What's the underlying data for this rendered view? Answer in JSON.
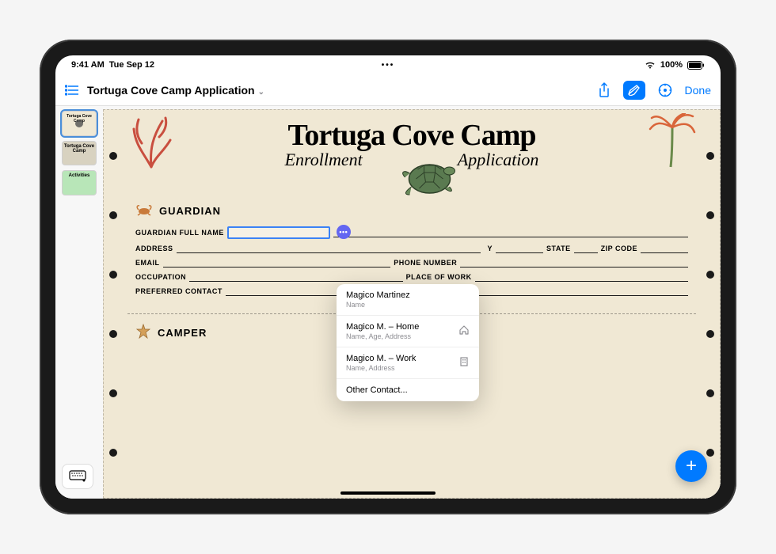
{
  "status": {
    "time": "9:41 AM",
    "date": "Tue Sep 12",
    "battery_pct": "100%"
  },
  "toolbar": {
    "title": "Tortuga Cove Camp Application",
    "done": "Done"
  },
  "sidebar": {
    "thumbs": [
      {
        "label": "Tortuga Cove Camp"
      },
      {
        "label": "Tortuga Cove Camp"
      },
      {
        "label": "Activities"
      }
    ]
  },
  "doc": {
    "title": "Tortuga Cove Camp",
    "sub_left": "Enrollment",
    "sub_right": "Application",
    "guardian_hdr": "GUARDIAN",
    "camper_hdr": "CAMPER",
    "labels": {
      "full_name": "GUARDIAN FULL NAME",
      "address": "ADDRESS",
      "city": "CITY",
      "state": "STATE",
      "zip": "ZIP CODE",
      "email": "EMAIL",
      "phone": "PHONE NUMBER",
      "occupation": "OCCUPATION",
      "place_work": "PLACE OF WORK",
      "pref_contact": "PREFERRED CONTACT"
    }
  },
  "popup": {
    "items": [
      {
        "main": "Magico Martinez",
        "sub": "Name",
        "icon": ""
      },
      {
        "main": "Magico M. – Home",
        "sub": "Name, Age, Address",
        "icon": "home"
      },
      {
        "main": "Magico M. – Work",
        "sub": "Name, Address",
        "icon": "building"
      }
    ],
    "other": "Other Contact..."
  }
}
